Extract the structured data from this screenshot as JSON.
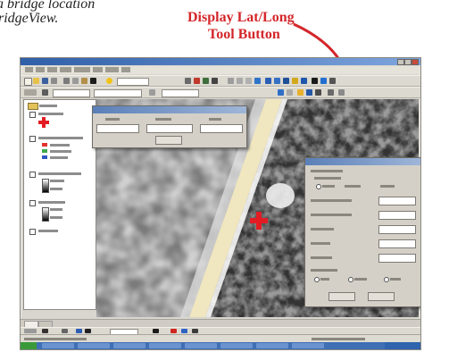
{
  "caption": {
    "line1": "a bridge location",
    "line2": "ridgeView."
  },
  "callout": {
    "line1": "Display Lat/Long",
    "line2": "Tool Button",
    "color": "#d4262a"
  },
  "app": {
    "title": "",
    "menu_items": [
      "",
      "",
      "",
      "",
      "",
      "",
      "",
      ""
    ],
    "layer_panel": {
      "layers": [
        "",
        "",
        "",
        "",
        "",
        ""
      ]
    },
    "status_text": ""
  },
  "small_dialog": {
    "title": "",
    "column_labels": [
      "",
      "",
      ""
    ],
    "field_values": [
      "",
      "",
      ""
    ],
    "button_label": ""
  },
  "latlong_dialog": {
    "title": "",
    "rows": [
      {
        "label": "",
        "value": ""
      },
      {
        "label": "",
        "value": ""
      },
      {
        "label": "",
        "value": ""
      },
      {
        "label": "",
        "value": ""
      },
      {
        "label": "",
        "value": ""
      }
    ],
    "options": [
      "",
      "",
      ""
    ],
    "buttons": [
      "",
      ""
    ]
  },
  "marker": {
    "icon": "red-cross-icon",
    "color": "#e31c23"
  }
}
